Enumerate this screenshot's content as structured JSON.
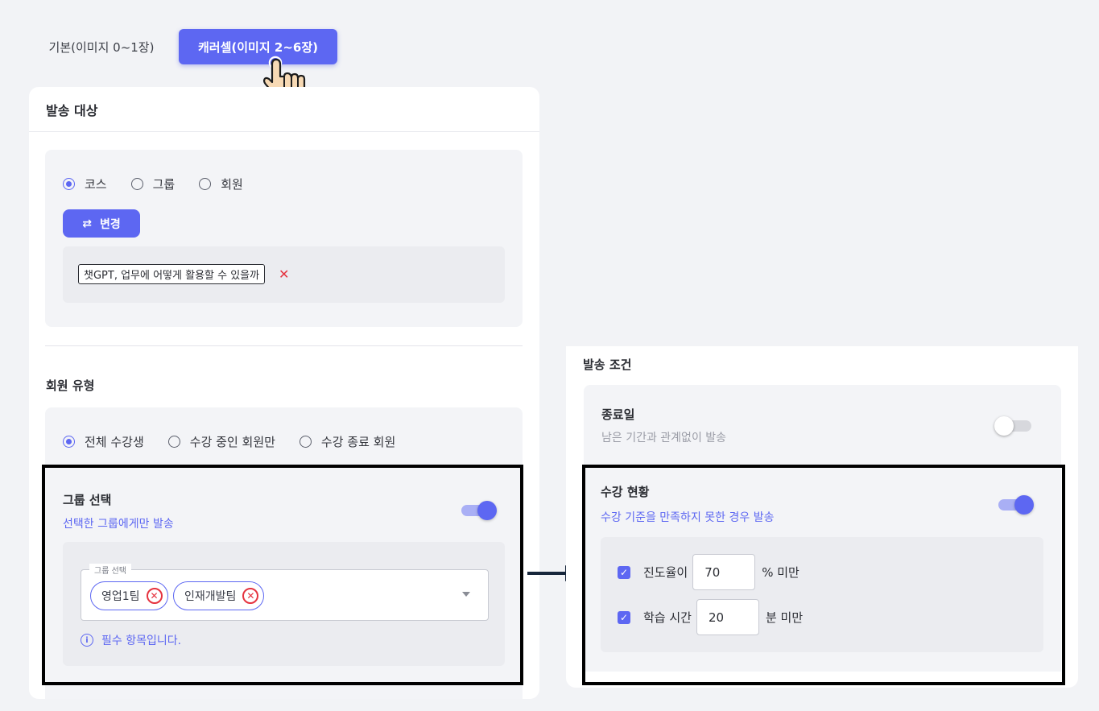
{
  "tabs": {
    "basic": "기본(이미지 0~1장)",
    "carousel": "캐러셀(이미지 2~6장)"
  },
  "target": {
    "header": "발송 대상",
    "radios": [
      "코스",
      "그룹",
      "회원"
    ],
    "change_button": "변경",
    "course_chip": "챗GPT, 업무에 어떻게 활용할 수 있을까",
    "remove_glyph": "✕"
  },
  "member_type": {
    "title": "회원 유형",
    "radios": [
      "전체 수강생",
      "수강 중인 회원만",
      "수강 종료 회원"
    ]
  },
  "group_select": {
    "title": "그룹 선택",
    "subtitle": "선택한 그룹에게만 발송",
    "field_label": "그룹 선택",
    "chips": [
      "영업1팀",
      "인재개발팀"
    ],
    "helper": "필수 항목입니다."
  },
  "conditions": {
    "title": "발송 조건",
    "end_date": {
      "title": "종료일",
      "subtitle": "남은 기간과 관계없이 발송"
    },
    "status": {
      "title": "수강 현황",
      "subtitle": "수강 기준을 만족하지 못한 경우 발송",
      "progress_label": "진도율이",
      "progress_value": "70",
      "progress_unit": "% 미만",
      "time_label": "학습 시간",
      "time_value": "20",
      "time_unit": "분 미만"
    }
  },
  "colors": {
    "accent": "#5d67f2",
    "remove": "#e5333f"
  },
  "icons": {
    "cursor": "pointing-hand-icon",
    "swap": "swap-arrows-icon",
    "info": "info-circle-icon",
    "check": "checkmark-icon"
  }
}
